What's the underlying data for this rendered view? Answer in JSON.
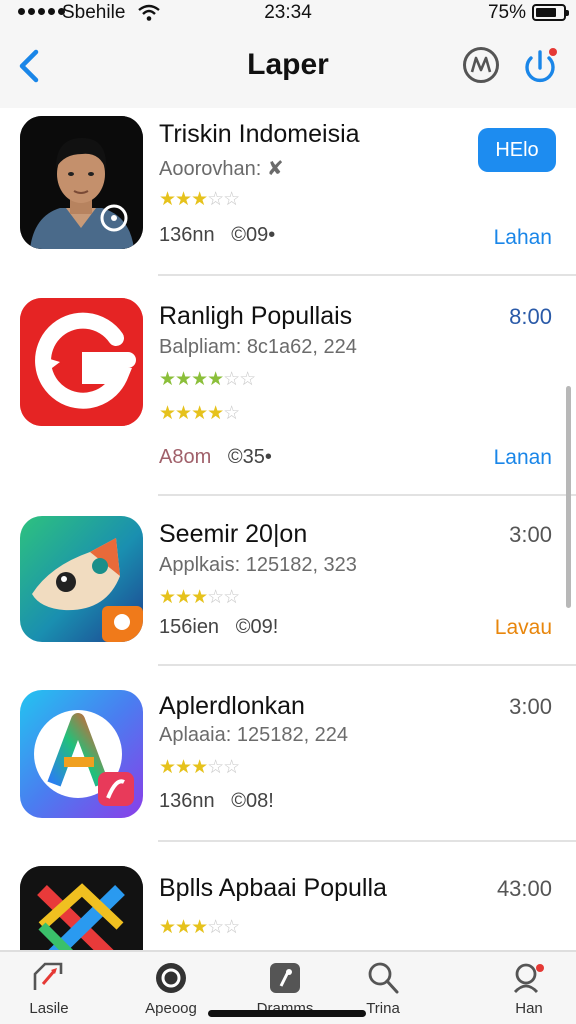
{
  "status_bar": {
    "carrier": "Sbehile",
    "time": "23:34",
    "battery": "75%",
    "battery_level": 0.75
  },
  "nav": {
    "title": "Laper",
    "back_icon": "chevron-left-icon",
    "icons": [
      "profile-circle-icon",
      "power-icon"
    ],
    "accent": "#1a86e8",
    "badge_color": "#e53935"
  },
  "apps": [
    {
      "title": "Triskin Indomeisia",
      "subtitle": "Aoorovhan: ✘",
      "rating": 3,
      "stars_text": "★★★☆☆",
      "meta": "136nn",
      "meta2": "©09•",
      "action": "HElo",
      "link": "Lahan"
    },
    {
      "title": "Ranligh Popullais",
      "subtitle": "Balpliam: 8c1a62, 224",
      "rating": 4,
      "stars_text": "★★★★☆☆",
      "stars_text2": "★★★★☆",
      "meta": "A8om",
      "meta2": "©35•",
      "price": "8:00",
      "link": "Lanan"
    },
    {
      "title": "Seemir 20|on",
      "subtitle": "Applkais: 125182, 323",
      "rating": 3.5,
      "stars_text": "★★★☆☆",
      "meta": "156ien",
      "meta2": "©09!",
      "price": "3:00",
      "link": "Lavau"
    },
    {
      "title": "Aplerdlonkan",
      "subtitle": "Aplaaia: 125182, 224",
      "rating": 3,
      "stars_text": "★★★☆☆",
      "meta": "136nn",
      "meta2": "©08!",
      "price": "3:00"
    },
    {
      "title": "Bplls Apbaai Populla",
      "rating": 3.5,
      "stars_text": "★★★☆☆",
      "price": "43:00"
    }
  ],
  "tabs": [
    {
      "label": "Lasile",
      "icon": "featured-icon"
    },
    {
      "label": "Apeoog",
      "icon": "apps-circle-icon"
    },
    {
      "label": "Dramms",
      "icon": "games-icon"
    },
    {
      "label": "Trina",
      "icon": "search-icon"
    },
    {
      "label": "Han",
      "icon": "account-icon"
    }
  ]
}
